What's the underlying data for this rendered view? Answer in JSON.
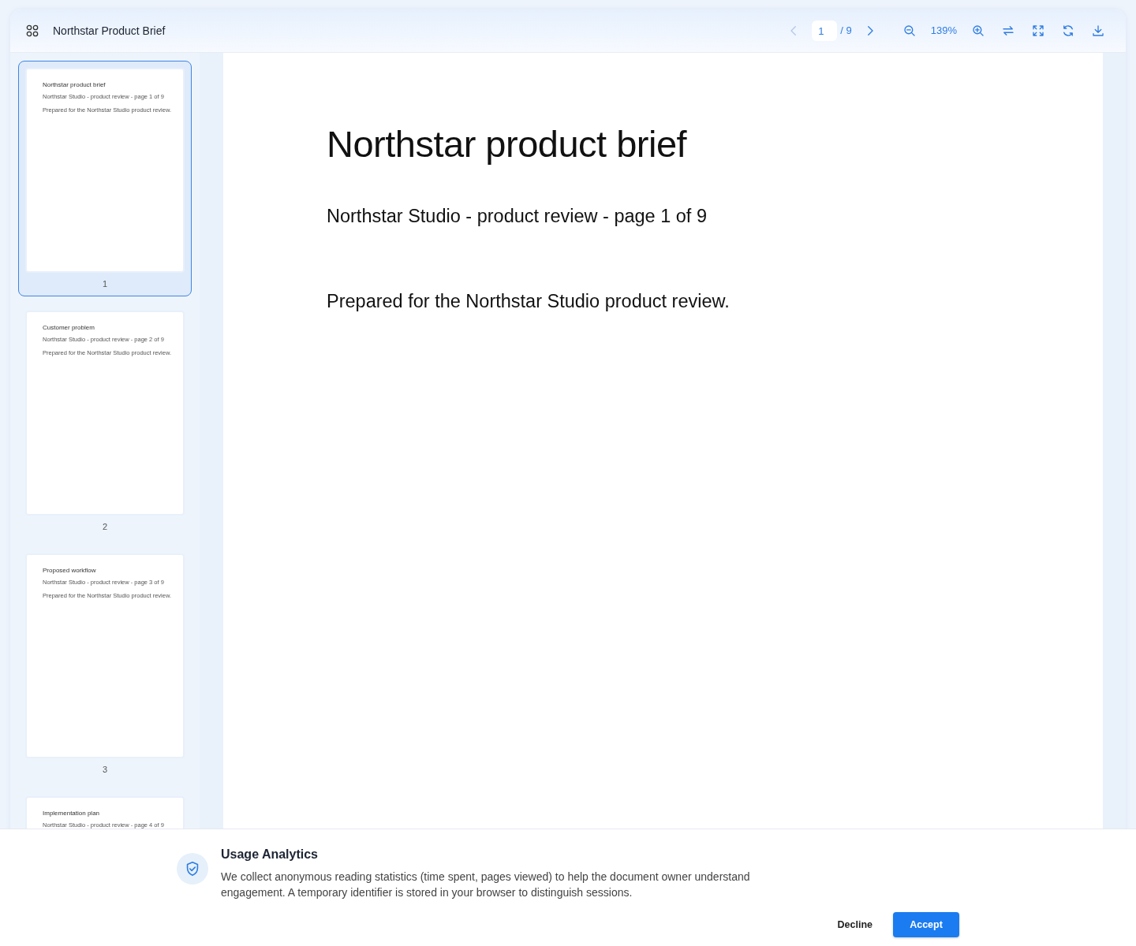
{
  "toolbar": {
    "title": "Northstar Product Brief",
    "prev": {
      "disabled": true
    },
    "next": {
      "disabled": false
    },
    "page_input": "1",
    "page_count": "/ 9",
    "zoom": "139%"
  },
  "thumbnails": [
    {
      "title": "Northstar product brief",
      "subtitle": "Northstar Studio - product review - page 1 of 9",
      "body": "Prepared for the Northstar Studio product review.",
      "label": "1",
      "selected": true
    },
    {
      "title": "Customer problem",
      "subtitle": "Northstar Studio - product review - page 2 of 9",
      "body": "Prepared for the Northstar Studio product review.",
      "label": "2",
      "selected": false
    },
    {
      "title": "Proposed workflow",
      "subtitle": "Northstar Studio - product review - page 3 of 9",
      "body": "Prepared for the Northstar Studio product review.",
      "label": "3",
      "selected": false
    },
    {
      "title": "Implementation plan",
      "subtitle": "Northstar Studio - product review - page 4 of 9",
      "selected": false
    }
  ],
  "page": {
    "title": "Northstar product brief",
    "subtitle": "Northstar Studio - product review - page 1 of 9",
    "body": "Prepared for the Northstar Studio product review."
  },
  "consent": {
    "title": "Usage Analytics",
    "text": "We collect anonymous reading statistics (time spent, pages viewed) to help the document owner understand engagement. A temporary identifier is stored in your browser to distinguish sessions.",
    "buttons": [
      {
        "label": "Decline",
        "kind": "secondary"
      },
      {
        "label": "Accept",
        "kind": "primary"
      }
    ]
  }
}
